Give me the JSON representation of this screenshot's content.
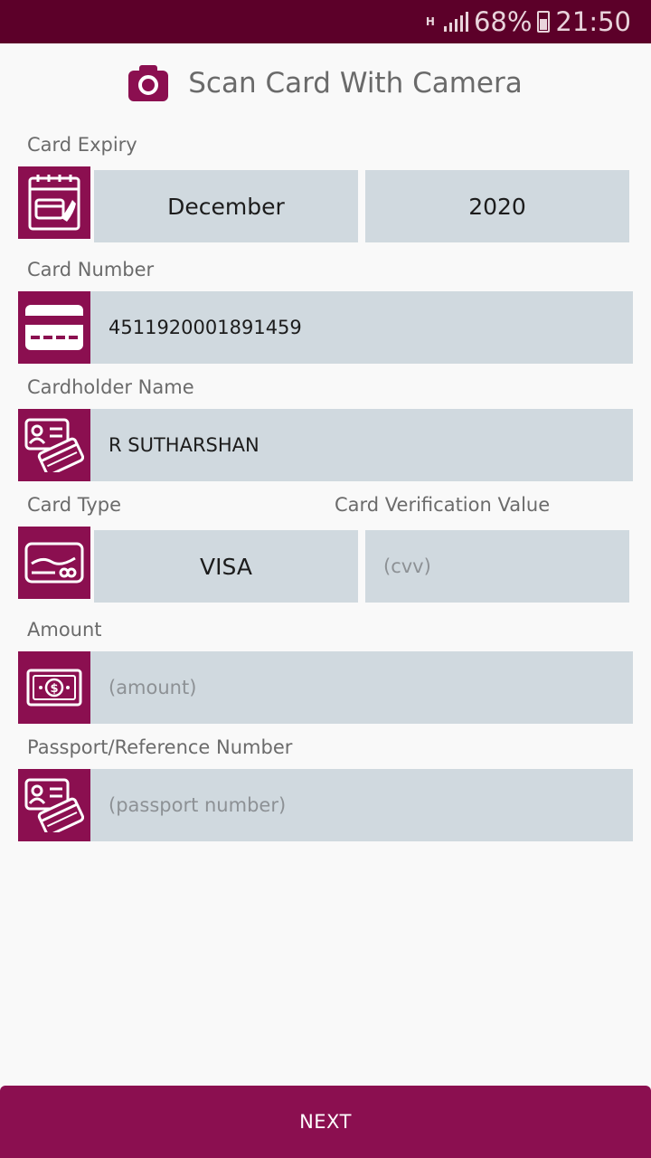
{
  "status_bar": {
    "network": "H",
    "battery": "68%",
    "time": "21:50"
  },
  "scan": {
    "label": "Scan Card With Camera",
    "icon": "camera-icon"
  },
  "expiry": {
    "label": "Card Expiry",
    "month": "December",
    "year": "2020",
    "icon": "calendar-card-icon"
  },
  "card_number": {
    "label": "Card Number",
    "value": "4511920001891459",
    "icon": "credit-card-icon"
  },
  "cardholder": {
    "label": "Cardholder Name",
    "value": "R SUTHARSHAN",
    "icon": "id-card-icon"
  },
  "card_type": {
    "label": "Card Type",
    "value": "VISA",
    "icon": "card-type-icon"
  },
  "cvv": {
    "label": "Card Verification Value",
    "placeholder": "(cvv)"
  },
  "amount": {
    "label": "Amount",
    "placeholder": "(amount)",
    "icon": "money-icon"
  },
  "passport": {
    "label": "Passport/Reference Number",
    "placeholder": "(passport number)",
    "icon": "id-card-icon"
  },
  "next_button": "NEXT",
  "colors": {
    "accent": "#8b0f50",
    "status_bar": "#5c0029",
    "field_bg": "#d0d9df"
  }
}
